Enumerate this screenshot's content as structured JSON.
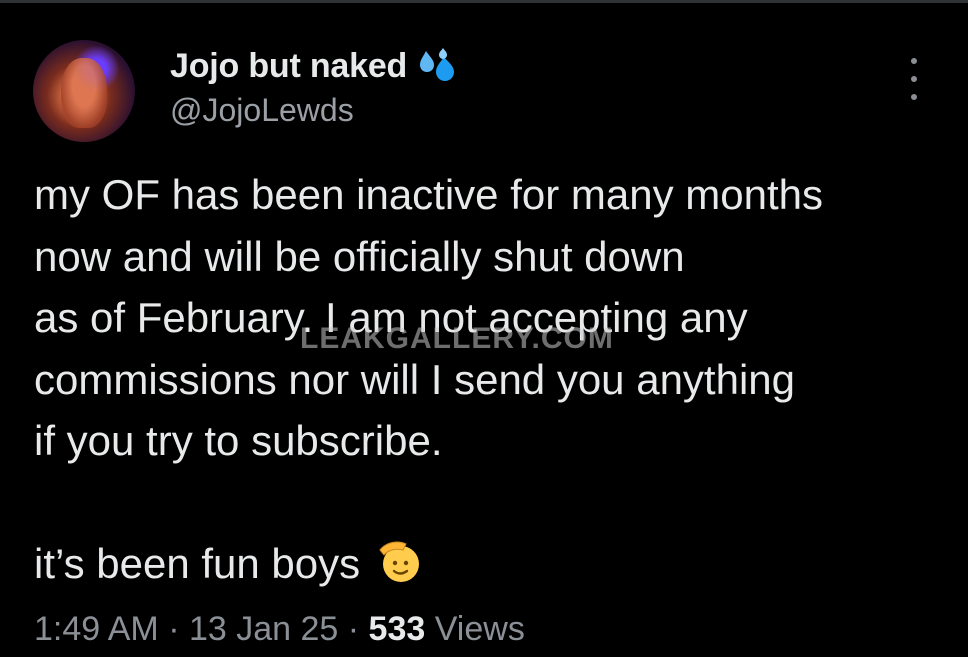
{
  "author": {
    "display_name": "Jojo but naked",
    "name_emoji": "sweat-droplets",
    "handle": "@JojoLewds"
  },
  "menu": {
    "icon": "more-vertical-icon"
  },
  "tweet": {
    "lines": [
      "my OF has been inactive for many months",
      "now and will be officially shut down",
      "as of February. I am not accepting any",
      "commissions nor will I send you anything",
      "if you try to subscribe."
    ],
    "closing": "it’s been fun boys",
    "closing_emoji": "saluting-face"
  },
  "watermark": "LEAKGALLERY.COM",
  "meta": {
    "time": "1:49 AM",
    "separator": " · ",
    "date": "13 Jan 25",
    "views_count": "533",
    "views_label": "Views"
  },
  "colors": {
    "background": "#000000",
    "primary_text": "#e7e9ea",
    "secondary_text": "#8b9096",
    "droplets": "#1d9bf0",
    "emoji_yellow": "#ffcc4d"
  }
}
